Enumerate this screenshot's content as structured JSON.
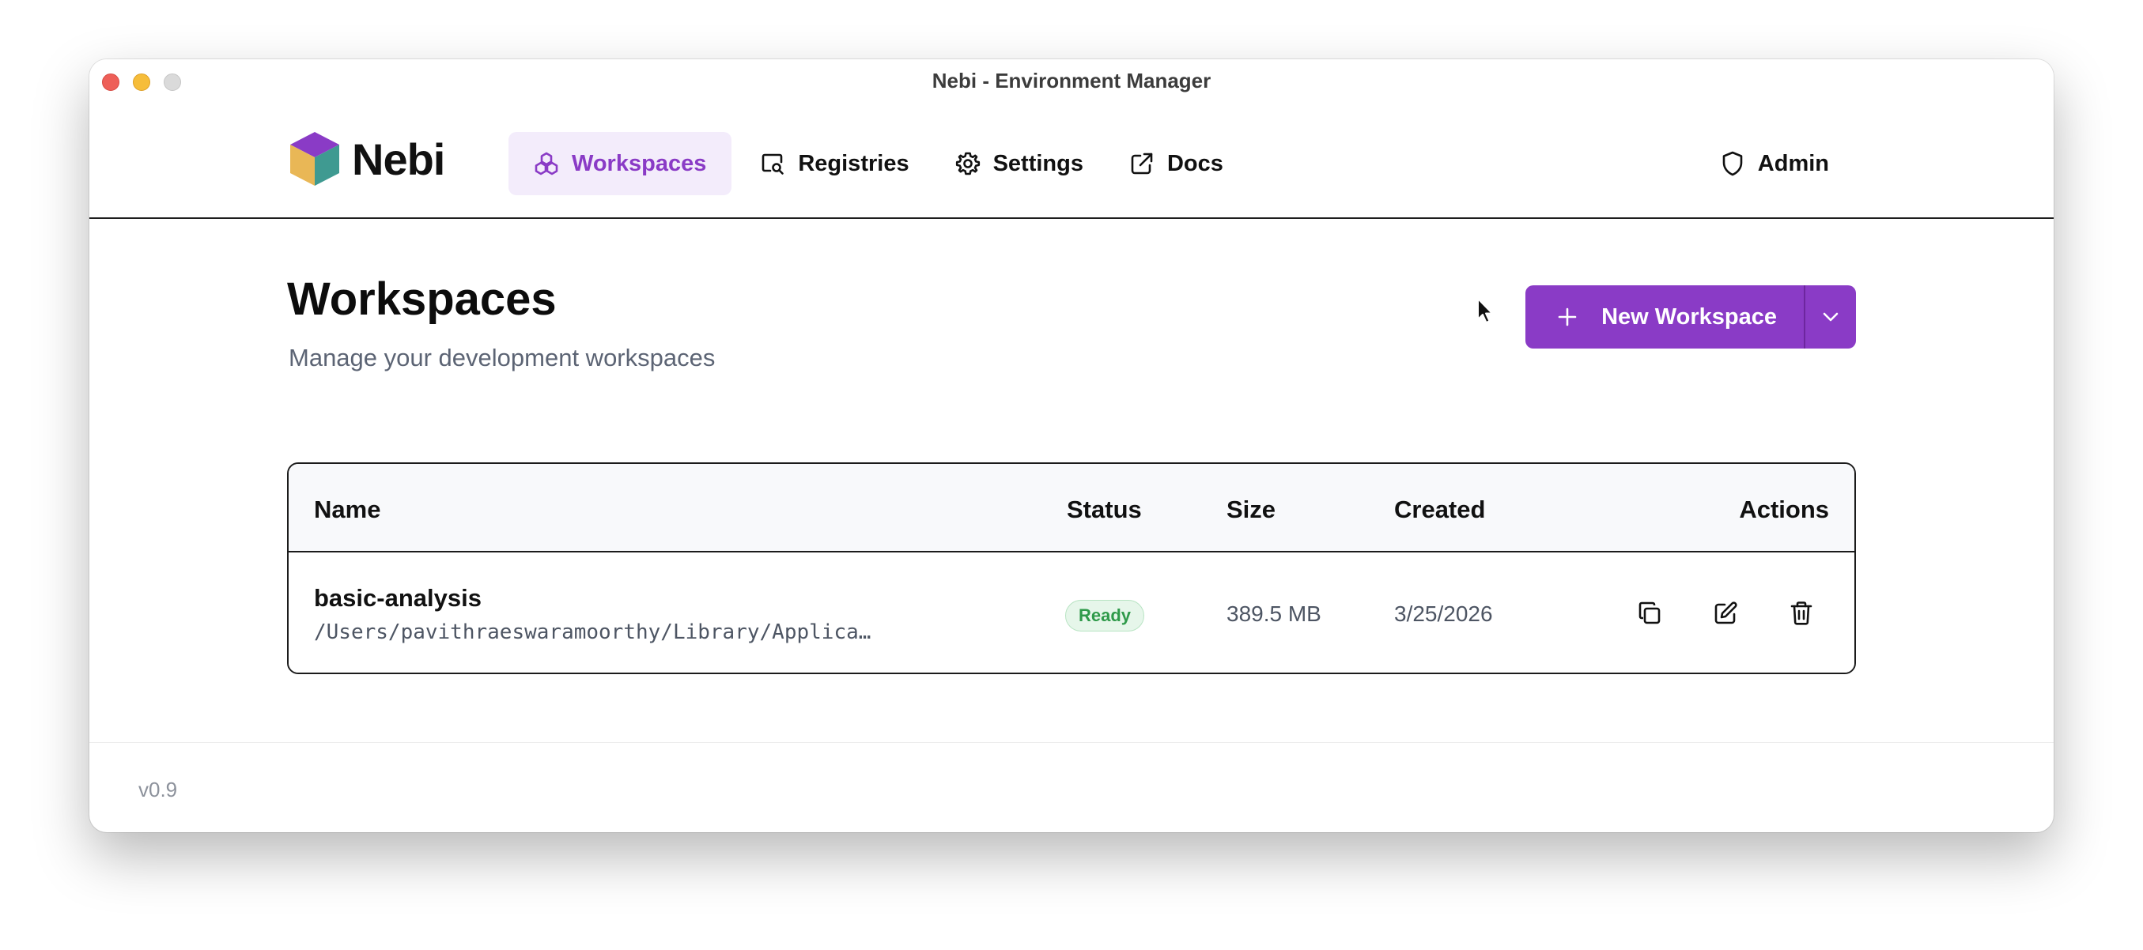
{
  "window": {
    "title": "Nebi - Environment Manager"
  },
  "navbar": {
    "logo_text": "Nebi",
    "items": [
      {
        "label": "Workspaces",
        "icon": "workspaces-icon",
        "active": true
      },
      {
        "label": "Registries",
        "icon": "registry-search-icon",
        "active": false
      },
      {
        "label": "Settings",
        "icon": "gear-icon",
        "active": false
      },
      {
        "label": "Docs",
        "icon": "external-link-icon",
        "active": false
      }
    ],
    "admin_label": "Admin"
  },
  "page": {
    "title": "Workspaces",
    "subtitle": "Manage your development workspaces",
    "new_workspace_label": "New Workspace"
  },
  "table": {
    "columns": [
      "Name",
      "Status",
      "Size",
      "Created",
      "Actions"
    ],
    "rows": [
      {
        "name": "basic-analysis",
        "path": "/Users/pavithraeswaramoorthy/Library/Applica…",
        "status": "Ready",
        "size": "389.5 MB",
        "created": "3/25/2026"
      }
    ]
  },
  "footer": {
    "version": "v0.9"
  },
  "colors": {
    "accent": "#8a3bc6",
    "accent_light": "#f3ecfb",
    "status_ready": "#2f9a4a"
  }
}
